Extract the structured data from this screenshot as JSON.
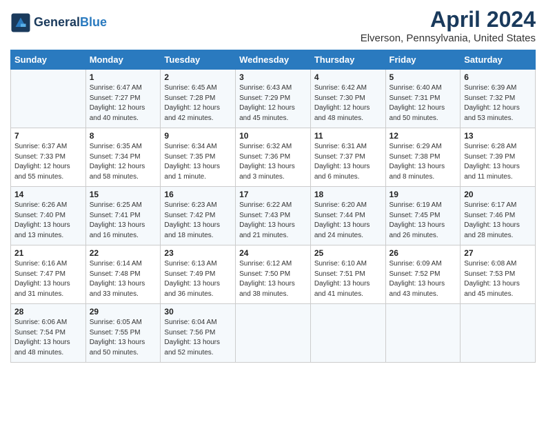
{
  "header": {
    "logo_line1": "General",
    "logo_line2": "Blue",
    "title": "April 2024",
    "subtitle": "Elverson, Pennsylvania, United States"
  },
  "columns": [
    "Sunday",
    "Monday",
    "Tuesday",
    "Wednesday",
    "Thursday",
    "Friday",
    "Saturday"
  ],
  "weeks": [
    [
      {
        "day": "",
        "info": ""
      },
      {
        "day": "1",
        "info": "Sunrise: 6:47 AM\nSunset: 7:27 PM\nDaylight: 12 hours\nand 40 minutes."
      },
      {
        "day": "2",
        "info": "Sunrise: 6:45 AM\nSunset: 7:28 PM\nDaylight: 12 hours\nand 42 minutes."
      },
      {
        "day": "3",
        "info": "Sunrise: 6:43 AM\nSunset: 7:29 PM\nDaylight: 12 hours\nand 45 minutes."
      },
      {
        "day": "4",
        "info": "Sunrise: 6:42 AM\nSunset: 7:30 PM\nDaylight: 12 hours\nand 48 minutes."
      },
      {
        "day": "5",
        "info": "Sunrise: 6:40 AM\nSunset: 7:31 PM\nDaylight: 12 hours\nand 50 minutes."
      },
      {
        "day": "6",
        "info": "Sunrise: 6:39 AM\nSunset: 7:32 PM\nDaylight: 12 hours\nand 53 minutes."
      }
    ],
    [
      {
        "day": "7",
        "info": "Sunrise: 6:37 AM\nSunset: 7:33 PM\nDaylight: 12 hours\nand 55 minutes."
      },
      {
        "day": "8",
        "info": "Sunrise: 6:35 AM\nSunset: 7:34 PM\nDaylight: 12 hours\nand 58 minutes."
      },
      {
        "day": "9",
        "info": "Sunrise: 6:34 AM\nSunset: 7:35 PM\nDaylight: 13 hours\nand 1 minute."
      },
      {
        "day": "10",
        "info": "Sunrise: 6:32 AM\nSunset: 7:36 PM\nDaylight: 13 hours\nand 3 minutes."
      },
      {
        "day": "11",
        "info": "Sunrise: 6:31 AM\nSunset: 7:37 PM\nDaylight: 13 hours\nand 6 minutes."
      },
      {
        "day": "12",
        "info": "Sunrise: 6:29 AM\nSunset: 7:38 PM\nDaylight: 13 hours\nand 8 minutes."
      },
      {
        "day": "13",
        "info": "Sunrise: 6:28 AM\nSunset: 7:39 PM\nDaylight: 13 hours\nand 11 minutes."
      }
    ],
    [
      {
        "day": "14",
        "info": "Sunrise: 6:26 AM\nSunset: 7:40 PM\nDaylight: 13 hours\nand 13 minutes."
      },
      {
        "day": "15",
        "info": "Sunrise: 6:25 AM\nSunset: 7:41 PM\nDaylight: 13 hours\nand 16 minutes."
      },
      {
        "day": "16",
        "info": "Sunrise: 6:23 AM\nSunset: 7:42 PM\nDaylight: 13 hours\nand 18 minutes."
      },
      {
        "day": "17",
        "info": "Sunrise: 6:22 AM\nSunset: 7:43 PM\nDaylight: 13 hours\nand 21 minutes."
      },
      {
        "day": "18",
        "info": "Sunrise: 6:20 AM\nSunset: 7:44 PM\nDaylight: 13 hours\nand 24 minutes."
      },
      {
        "day": "19",
        "info": "Sunrise: 6:19 AM\nSunset: 7:45 PM\nDaylight: 13 hours\nand 26 minutes."
      },
      {
        "day": "20",
        "info": "Sunrise: 6:17 AM\nSunset: 7:46 PM\nDaylight: 13 hours\nand 28 minutes."
      }
    ],
    [
      {
        "day": "21",
        "info": "Sunrise: 6:16 AM\nSunset: 7:47 PM\nDaylight: 13 hours\nand 31 minutes."
      },
      {
        "day": "22",
        "info": "Sunrise: 6:14 AM\nSunset: 7:48 PM\nDaylight: 13 hours\nand 33 minutes."
      },
      {
        "day": "23",
        "info": "Sunrise: 6:13 AM\nSunset: 7:49 PM\nDaylight: 13 hours\nand 36 minutes."
      },
      {
        "day": "24",
        "info": "Sunrise: 6:12 AM\nSunset: 7:50 PM\nDaylight: 13 hours\nand 38 minutes."
      },
      {
        "day": "25",
        "info": "Sunrise: 6:10 AM\nSunset: 7:51 PM\nDaylight: 13 hours\nand 41 minutes."
      },
      {
        "day": "26",
        "info": "Sunrise: 6:09 AM\nSunset: 7:52 PM\nDaylight: 13 hours\nand 43 minutes."
      },
      {
        "day": "27",
        "info": "Sunrise: 6:08 AM\nSunset: 7:53 PM\nDaylight: 13 hours\nand 45 minutes."
      }
    ],
    [
      {
        "day": "28",
        "info": "Sunrise: 6:06 AM\nSunset: 7:54 PM\nDaylight: 13 hours\nand 48 minutes."
      },
      {
        "day": "29",
        "info": "Sunrise: 6:05 AM\nSunset: 7:55 PM\nDaylight: 13 hours\nand 50 minutes."
      },
      {
        "day": "30",
        "info": "Sunrise: 6:04 AM\nSunset: 7:56 PM\nDaylight: 13 hours\nand 52 minutes."
      },
      {
        "day": "",
        "info": ""
      },
      {
        "day": "",
        "info": ""
      },
      {
        "day": "",
        "info": ""
      },
      {
        "day": "",
        "info": ""
      }
    ]
  ]
}
